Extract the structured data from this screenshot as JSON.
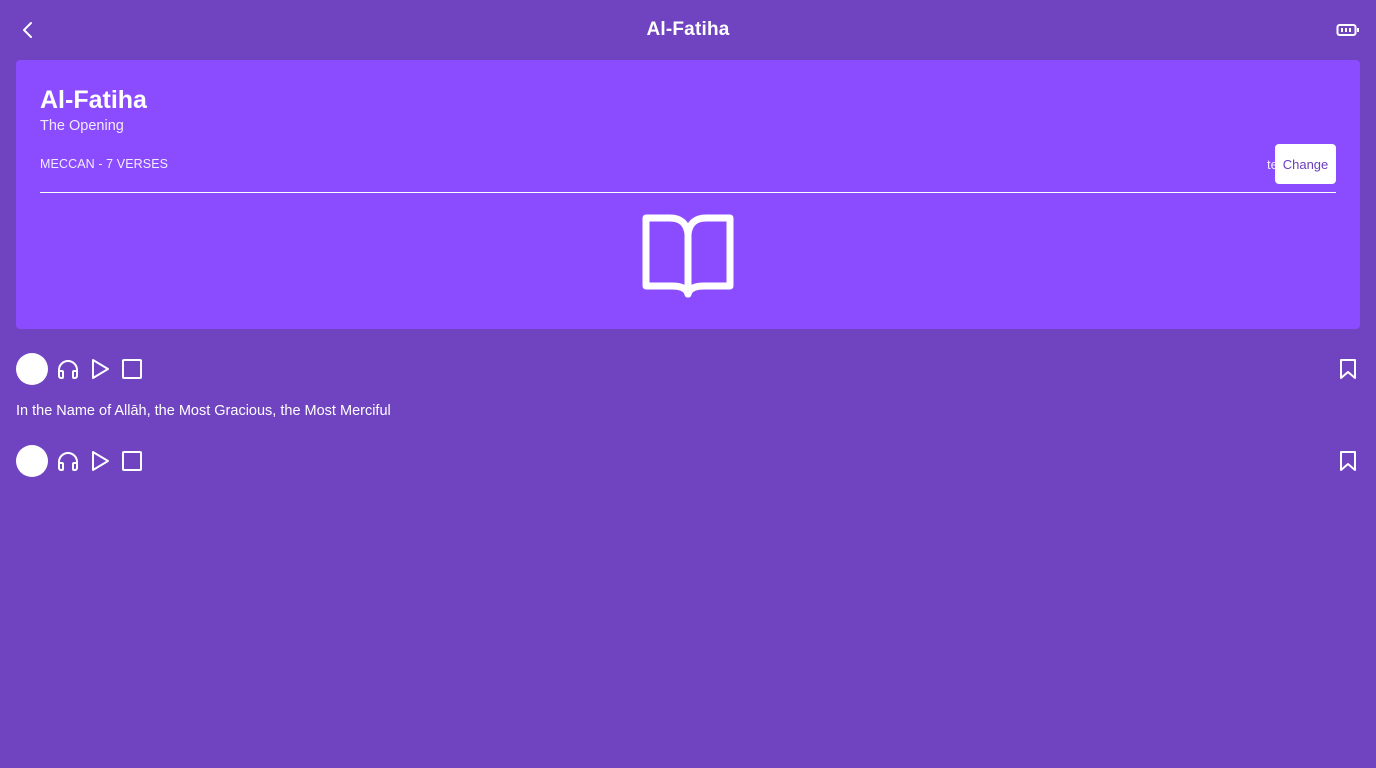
{
  "header": {
    "title": "Al-Fatiha",
    "back_icon": "chevron-left-icon",
    "right_icon": "battery-icon"
  },
  "surah_card": {
    "name": "Al-Fatiha",
    "translation": "The Opening",
    "meta": "MECCAN - 7 VERSES",
    "reciter": "test",
    "change_label": "Change",
    "icon": "open-book-icon",
    "background": "#8a4cfe"
  },
  "verses": [
    {
      "text": "In the Name of Allāh, the Most Gracious, the Most Merciful",
      "controls": [
        "headphones-icon",
        "play-icon",
        "stop-icon",
        "bookmark-icon"
      ]
    },
    {
      "text": "",
      "controls": [
        "headphones-icon",
        "play-icon",
        "stop-icon",
        "bookmark-icon"
      ]
    }
  ],
  "colors": {
    "page_background": "#7043c1",
    "card_background": "#8a4cfe",
    "accent_text": "#6a3dbd"
  }
}
